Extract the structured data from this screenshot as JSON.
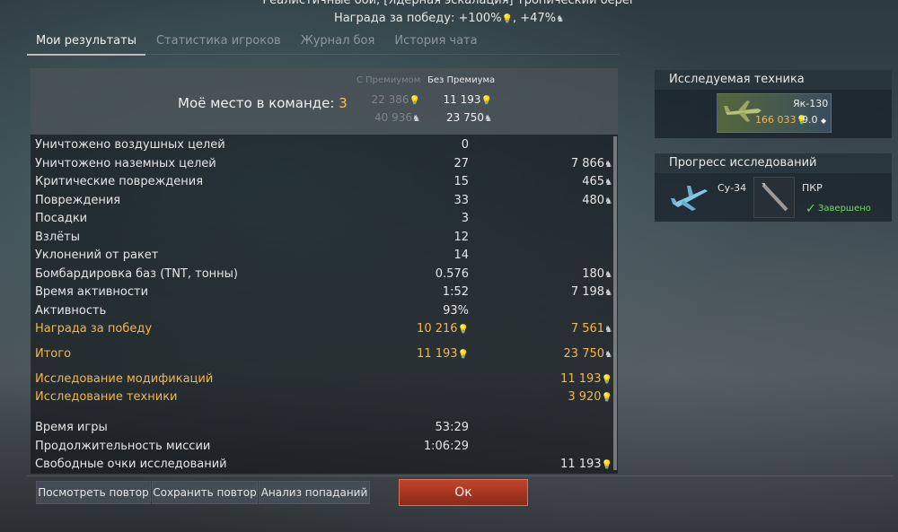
{
  "header": {
    "mission_title": "Реалистичные бои, [Ядерная эскалация] Тропический берег",
    "reward_prefix": "Награда за победу: ",
    "reward_rp": "+100%",
    "reward_sl": "+47%"
  },
  "tabs": [
    {
      "label": "Мои результаты",
      "active": true
    },
    {
      "label": "Статистика игроков",
      "active": false
    },
    {
      "label": "Журнал боя",
      "active": false
    },
    {
      "label": "История чата",
      "active": false
    }
  ],
  "place": {
    "label": "Моё место в команде:",
    "value": "3",
    "col_premium": "С Премиумом",
    "col_no_premium": "Без Премиума",
    "premium_rp": "22 386",
    "premium_sl": "40 936",
    "base_rp": "11 193",
    "base_sl": "23 750"
  },
  "stats": [
    {
      "label": "Уничтожено воздушных целей",
      "value": "0",
      "reward": "",
      "gold": false,
      "reward_icon": ""
    },
    {
      "label": "Уничтожено наземных целей",
      "value": "27",
      "reward": "7 866",
      "gold": false,
      "reward_icon": "lion"
    },
    {
      "label": "Критические повреждения",
      "value": "15",
      "reward": "465",
      "gold": false,
      "reward_icon": "lion"
    },
    {
      "label": "Повреждения",
      "value": "33",
      "reward": "480",
      "gold": false,
      "reward_icon": "lion"
    },
    {
      "label": "Посадки",
      "value": "3",
      "reward": "",
      "gold": false,
      "reward_icon": ""
    },
    {
      "label": "Взлёты",
      "value": "12",
      "reward": "",
      "gold": false,
      "reward_icon": ""
    },
    {
      "label": "Уклонений от ракет",
      "value": "14",
      "reward": "",
      "gold": false,
      "reward_icon": ""
    },
    {
      "label": "Бомбардировка баз (TNT, тонны)",
      "value": "0.576",
      "reward": "180",
      "gold": false,
      "reward_icon": "lion"
    },
    {
      "label": "Время активности",
      "value": "1:52",
      "reward": "7 198",
      "gold": false,
      "reward_icon": "lion"
    },
    {
      "label": "Активность",
      "value": "93%",
      "reward": "",
      "gold": false,
      "reward_icon": ""
    },
    {
      "label": "Награда за победу",
      "value": "10 216",
      "reward": "7 561",
      "gold": true,
      "value_icon": "rp",
      "reward_icon": "lion"
    }
  ],
  "totals": {
    "label": "Итого",
    "rp": "11 193",
    "sl": "23 750"
  },
  "research": [
    {
      "label": "Исследование модификаций",
      "value": "11 193"
    },
    {
      "label": "Исследование техники",
      "value": "3 920"
    }
  ],
  "summary": [
    {
      "label": "Время игры",
      "value": "53:29",
      "reward": ""
    },
    {
      "label": "Продолжительность миссии",
      "value": "1:06:29",
      "reward": ""
    },
    {
      "label": "Свободные очки исследований",
      "value": "",
      "reward": "11 193"
    }
  ],
  "buttons": {
    "replay": "Посмотреть повтор",
    "save_replay": "Сохранить повтор",
    "hit_analysis": "Анализ попаданий",
    "ok": "Ок"
  },
  "researched_vehicle": {
    "heading": "Исследуемая техника",
    "name": "Як-130",
    "cost": "166 033",
    "br": "9.0"
  },
  "research_progress": {
    "heading": "Прогресс исследований",
    "vehicle": "Су-34",
    "module": "ПКР",
    "status": "Завершено"
  },
  "colors": {
    "gold": "#f3b64a",
    "ok_button": "#c2432a",
    "complete": "#7bd26b"
  },
  "icons": {
    "rp": "research-points-icon",
    "sl": "silver-lions-icon",
    "free_rp": "free-research-points-icon"
  }
}
